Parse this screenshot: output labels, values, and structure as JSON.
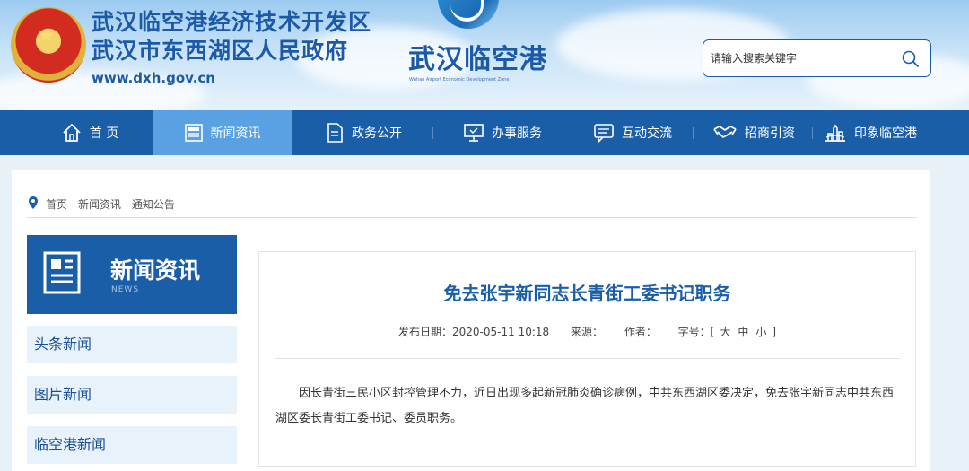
{
  "header": {
    "title_line1": "武汉临空港经济技术开发区",
    "title_line2": "武汉市东西湖区人民政府",
    "url": "www.dxh.gov.cn",
    "logo_text": "武汉临空港",
    "logo_sub": "Wuhan Airport Economic Development Zone"
  },
  "search": {
    "placeholder": "请输入搜索关键字"
  },
  "nav": {
    "items": [
      {
        "label": "首 页",
        "icon": "home-icon"
      },
      {
        "label": "新闻资讯",
        "icon": "news-doc-icon"
      },
      {
        "label": "政务公开",
        "icon": "document-icon"
      },
      {
        "label": "办事服务",
        "icon": "monitor-icon"
      },
      {
        "label": "互动交流",
        "icon": "chat-icon"
      },
      {
        "label": "招商引资",
        "icon": "handshake-icon"
      },
      {
        "label": "印象临空港",
        "icon": "landmark-icon"
      }
    ]
  },
  "breadcrumb": "首页 - 新闻资讯 - 通知公告",
  "sidebar": {
    "title": "新闻资讯",
    "subtitle": "NEWS",
    "items": [
      "头条新闻",
      "图片新闻",
      "临空港新闻"
    ]
  },
  "article": {
    "title": "免去张宇新同志长青街工委书记职务",
    "date_label": "发布日期：",
    "date": "2020-05-11 10:18",
    "source_label": "来源：",
    "author_label": "作者：",
    "fontsize_label": "字号：[",
    "fontsize_large": "大",
    "fontsize_medium": "中",
    "fontsize_small": "小",
    "fontsize_close": "]",
    "body": "因长青街三民小区封控管理不力，近日出现多起新冠肺炎确诊病例，中共东西湖区委决定，免去张宇新同志中共东西湖区委长青街工委书记、委员职务。"
  },
  "colors": {
    "primary": "#1a5ea8",
    "nav_active": "#5aa1e3",
    "sidebar_item_bg": "#e8f2fb"
  }
}
